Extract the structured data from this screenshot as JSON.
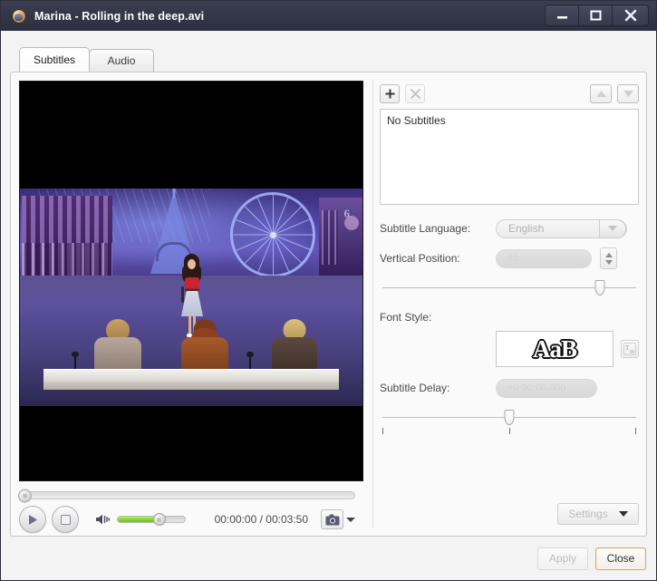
{
  "window": {
    "title": "Marina - Rolling in the deep.avi",
    "app_icon": "media-player-icon",
    "minimize_label": "minimize-icon",
    "maximize_label": "maximize-icon",
    "close_label": "close-icon"
  },
  "tabs": [
    {
      "label": "Subtitles",
      "active": true
    },
    {
      "label": "Audio",
      "active": false
    }
  ],
  "player": {
    "play_icon": "play-icon",
    "stop_icon": "stop-icon",
    "volume_icon": "speaker-icon",
    "volume_percent": 62,
    "seek_percent": 0,
    "timecode": "00:00:00 / 00:03:50",
    "current_time": "00:00:00",
    "total_time": "00:03:50",
    "snapshot_icon": "camera-icon",
    "snapshot_caret": "chevron-down-icon"
  },
  "subtitles": {
    "add_label": "+",
    "add_icon": "plus-icon",
    "remove_label": "×",
    "remove_icon": "cross-icon",
    "move_up_icon": "arrow-up-icon",
    "move_down_icon": "arrow-down-icon",
    "list_items": [
      "No Subtitles"
    ],
    "language_label": "Subtitle Language:",
    "language_value": "English",
    "language_caret": "chevron-down-icon",
    "vertical_position_label": "Vertical Position:",
    "vertical_position_value": "85",
    "vertical_position_percent": 85,
    "font_style_label": "Font Style:",
    "font_style_preview": "AaB",
    "font_picker_icon": "font-picker-icon",
    "delay_label": "Subtitle Delay:",
    "delay_value": "+0:00:00.000",
    "delay_percent": 50,
    "settings_label": "Settings",
    "settings_caret": "chevron-down-icon"
  },
  "footer": {
    "apply_label": "Apply",
    "close_label": "Close"
  },
  "colors": {
    "titlebar": "#333748",
    "accent_volume": "#7fd227",
    "default_button_border": "#d7a86a"
  }
}
